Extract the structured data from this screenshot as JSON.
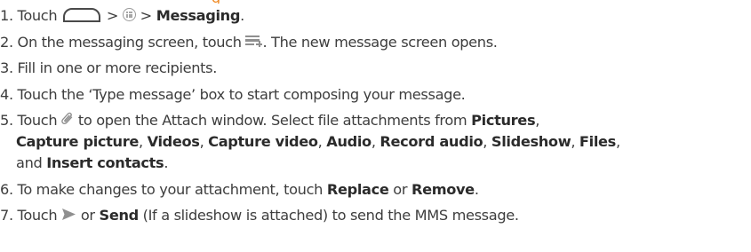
{
  "header": {
    "orange_tail": "g"
  },
  "steps": [
    {
      "num": "1.",
      "touch": "Touch",
      "sep1": ">",
      "sep2": ">",
      "target": "Messaging",
      "end": "."
    },
    {
      "num": "2.",
      "before": "On the messaging screen, touch",
      "after": ". The new message screen opens."
    },
    {
      "num": "3.",
      "text": "Fill in one or more recipients."
    },
    {
      "num": "4.",
      "text": "Touch the ‘Type message’ box to start composing your message."
    },
    {
      "num": "5.",
      "touch": "Touch",
      "after_icon": "to open the Attach window. Select file attachments from",
      "opt_pictures": "Pictures",
      "opt_capture_picture": "Capture picture",
      "opt_videos": "Videos",
      "opt_capture_video": "Capture video",
      "opt_audio": "Audio",
      "opt_record_audio": "Record audio",
      "opt_slideshow": "Slideshow",
      "opt_files": "Files",
      "and": "and",
      "opt_insert_contacts": "Insert contacts",
      "comma": ",",
      "end": "."
    },
    {
      "num": "6.",
      "before": "To make changes to your attachment, touch",
      "replace": "Replace",
      "or": "or",
      "remove": "Remove",
      "end": "."
    },
    {
      "num": "7.",
      "touch": "Touch",
      "or": "or",
      "send": "Send",
      "after": "(If a slideshow is attached) to send the MMS message."
    }
  ],
  "icons": {
    "home": "home-icon",
    "apps": "apps-icon",
    "new_message": "new-message-icon",
    "attach": "paperclip-icon",
    "send": "send-icon"
  },
  "colors": {
    "text": "#3d3d3d",
    "bold": "#2b2b2b",
    "accent": "#f08a24",
    "icon_grey": "#8f8f8f"
  }
}
